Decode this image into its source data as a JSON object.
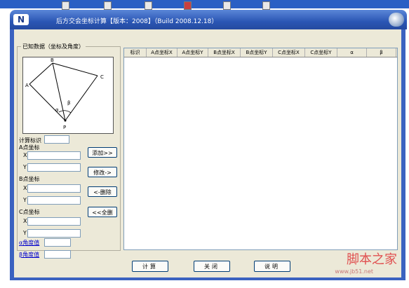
{
  "window": {
    "title": "后方交会坐标计算【版本：2008】（Build 2008.12.18）"
  },
  "known_data": {
    "legend": "已知数据（坐标及角度）",
    "diagram_labels": {
      "A": "A",
      "B": "B",
      "C": "C",
      "P": "P",
      "alpha": "α",
      "beta": "β"
    }
  },
  "fields": {
    "calc_id_label": "计算标识",
    "a_label": "A点坐标",
    "b_label": "B点坐标",
    "c_label": "C点坐标",
    "x_label": "X",
    "y_label": "Y",
    "alpha_label": "α角度值",
    "beta_label": "β角度值"
  },
  "side_buttons": {
    "add": "添加>>",
    "modify": "修改->",
    "delete": "<-删除",
    "delete_all": "<<全删"
  },
  "table": {
    "columns": [
      "标识",
      "A点坐标X",
      "A点坐标Y",
      "B点坐标X",
      "B点坐标Y",
      "C点坐标X",
      "C点坐标Y",
      "α",
      "β"
    ]
  },
  "bottom_buttons": {
    "calc": "计算",
    "close": "关闭",
    "about": "说明"
  },
  "watermark": {
    "text": "脚本之家",
    "url": "www.jb51.net"
  }
}
